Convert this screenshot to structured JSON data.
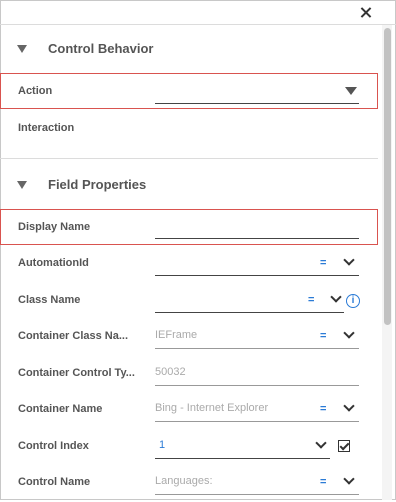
{
  "sections": {
    "control_behavior": {
      "title": "Control Behavior",
      "rows": [
        {
          "label": "Action",
          "value": ""
        },
        {
          "label": "Interaction",
          "value": ""
        }
      ]
    },
    "field_properties": {
      "title": "Field Properties",
      "rows": [
        {
          "label": "Display Name",
          "value": ""
        },
        {
          "label": "AutomationId",
          "value": "",
          "indicator": "="
        },
        {
          "label": "Class Name",
          "value": "",
          "indicator": "="
        },
        {
          "label": "Container Class Na...",
          "value": "IEFrame",
          "indicator": "="
        },
        {
          "label": "Container Control Ty...",
          "value": "50032"
        },
        {
          "label": "Container Name",
          "value": "Bing - Internet Explorer",
          "indicator": "="
        },
        {
          "label": "Control Index",
          "value": "1"
        },
        {
          "label": "Control Name",
          "value": "Languages:",
          "indicator": "="
        }
      ]
    }
  },
  "icons": {
    "close": "close-icon",
    "section_toggle": "caret-down-icon",
    "dropdown": "chevron-down-icon",
    "info": "info-icon",
    "checkbox": "checkbox-checked-icon"
  },
  "colors": {
    "accent": "#2b7bd6",
    "highlight": "#d9534f",
    "text": "#555555"
  }
}
